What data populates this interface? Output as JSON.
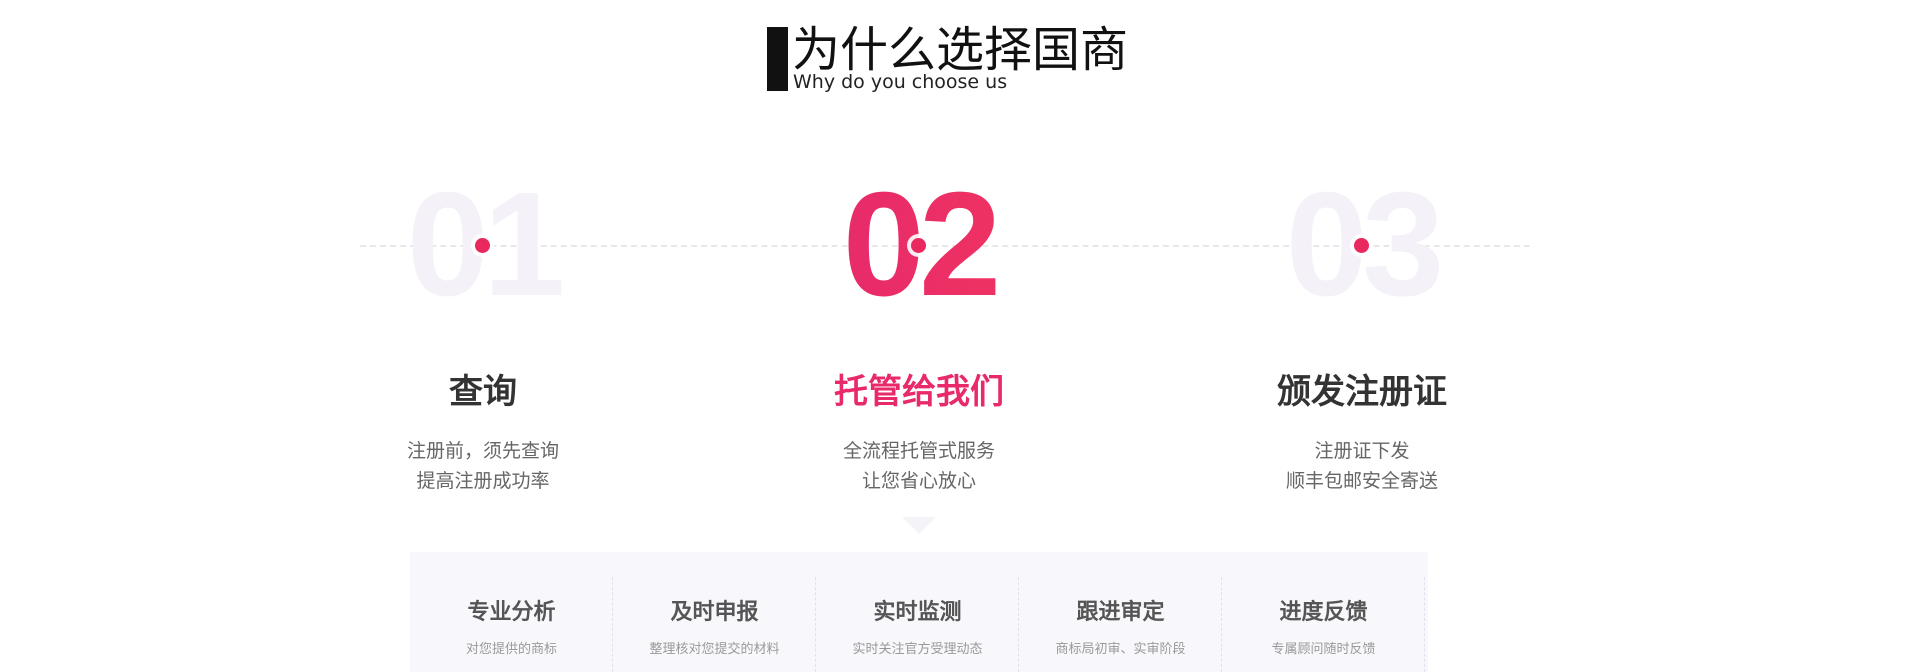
{
  "section": {
    "title": "为什么选择国商",
    "subtitle": "Why do you choose us"
  },
  "steps": [
    {
      "number": "01",
      "title": "查询",
      "desc_lines": [
        "注册前，须先查询",
        "提高注册成功率"
      ],
      "active": false
    },
    {
      "number": "02",
      "title": "托管给我们",
      "desc_lines": [
        "全流程托管式服务",
        "让您省心放心"
      ],
      "active": true
    },
    {
      "number": "03",
      "title": "颁发注册证",
      "desc_lines": [
        "注册证下发",
        "顺丰包邮安全寄送"
      ],
      "active": false
    }
  ],
  "features": [
    {
      "title": "专业分析",
      "desc": "对您提供的商标"
    },
    {
      "title": "及时申报",
      "desc": "整理核对您提交的材料"
    },
    {
      "title": "实时监测",
      "desc": "实时关注官方受理动态"
    },
    {
      "title": "跟进审定",
      "desc": "商标局初审、实审阶段"
    },
    {
      "title": "进度反馈",
      "desc": "专属顾问随时反馈"
    }
  ],
  "colors": {
    "accent": "#e82a6a",
    "inactive_number": "#f4f2f8",
    "dot": "#e8285e",
    "panel_bg": "#f8f7fb"
  }
}
